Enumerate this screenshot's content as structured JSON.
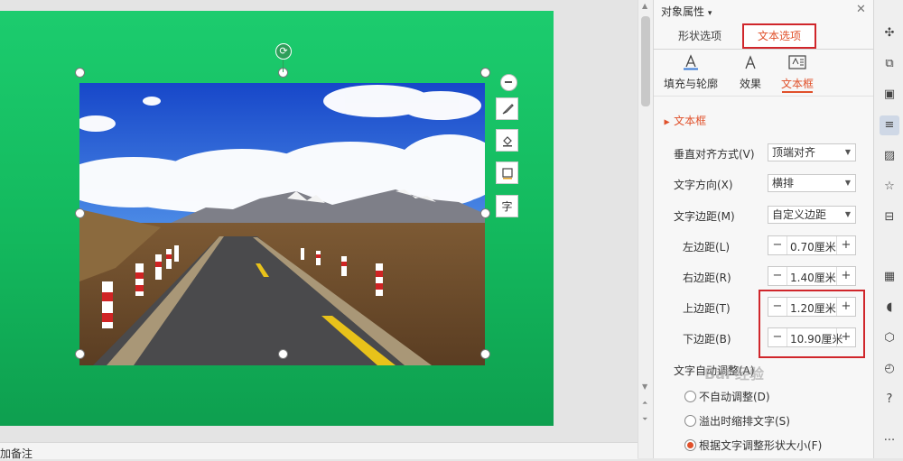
{
  "notes": {
    "label": "加备注"
  },
  "panel": {
    "title": "对象属性",
    "title_caret": "▾",
    "close_icon": "close-icon",
    "tabs": [
      {
        "label": "形状选项",
        "active": false
      },
      {
        "label": "文本选项",
        "active": true
      }
    ],
    "sub_tabs": [
      {
        "label": "填充与轮廓",
        "icon": "text-fill-icon"
      },
      {
        "label": "效果",
        "icon": "text-effect-icon"
      },
      {
        "label": "文本框",
        "icon": "textbox-icon",
        "active": true
      }
    ],
    "section": "文本框",
    "fields": {
      "vertical_align": {
        "label": "垂直对齐方式(V)",
        "value": "顶端对齐"
      },
      "text_direction": {
        "label": "文字方向(X)",
        "value": "横排"
      },
      "text_margin": {
        "label": "文字边距(M)",
        "value": "自定义边距"
      },
      "left_margin": {
        "label": "左边距(L)",
        "value": "0.70厘米"
      },
      "right_margin": {
        "label": "右边距(R)",
        "value": "1.40厘米"
      },
      "top_margin": {
        "label": "上边距(T)",
        "value": "1.20厘米"
      },
      "bottom_margin": {
        "label": "下边距(B)",
        "value": "10.90厘米"
      }
    },
    "autofit": {
      "label": "文字自动调整(A)",
      "options": [
        {
          "label": "不自动调整(D)",
          "selected": false
        },
        {
          "label": "溢出时缩排文字(S)",
          "selected": false
        },
        {
          "label": "根据文字调整形状大小(F)",
          "selected": true
        }
      ]
    },
    "stepper": {
      "minus": "−",
      "plus": "+"
    }
  },
  "float_toolbar": [
    "collapse-icon",
    "brush-icon",
    "fill-bucket-icon",
    "outline-icon",
    "text-icon"
  ],
  "float_text_icon_glyph": "字",
  "watermark": "Bai 经验",
  "rail": [
    "pin-icon",
    "copy-layout-icon",
    "image-edit-icon",
    "properties-icon",
    "picture-icon",
    "star-icon",
    "archive-icon",
    "image-icon",
    "audio-icon",
    "shield-icon",
    "history-icon",
    "help-icon",
    "more-icon"
  ],
  "rail_glyphs": [
    "✣",
    "⧉",
    "▣",
    "≡",
    "▨",
    "☆",
    "⊟",
    "▦",
    "◖",
    "⬡",
    "◴",
    "?",
    "···"
  ],
  "colors": {
    "accent": "#e0502a",
    "highlight_border": "#d0262b",
    "slide_green": "#19c168"
  }
}
